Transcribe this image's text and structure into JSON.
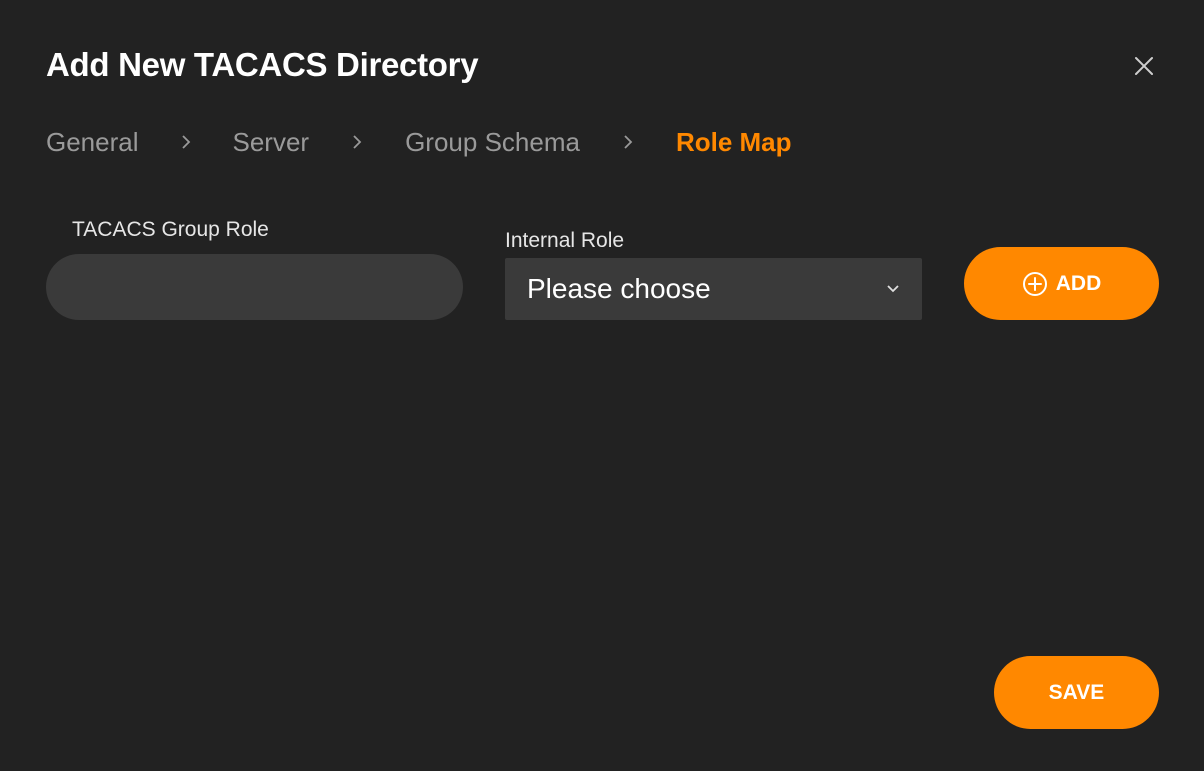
{
  "dialog": {
    "title": "Add New TACACS Directory"
  },
  "breadcrumb": {
    "steps": [
      {
        "label": "General",
        "active": false
      },
      {
        "label": "Server",
        "active": false
      },
      {
        "label": "Group Schema",
        "active": false
      },
      {
        "label": "Role Map",
        "active": true
      }
    ]
  },
  "form": {
    "group_role_label": "TACACS Group Role",
    "group_role_value": "",
    "internal_role_label": "Internal Role",
    "internal_role_selected": "Please choose",
    "add_label": "ADD"
  },
  "footer": {
    "save_label": "SAVE"
  },
  "colors": {
    "background": "#222222",
    "accent": "#ff8800",
    "input_bg": "#3a3a3a",
    "muted_text": "#9a9a9a"
  },
  "icons": {
    "close": "close-icon",
    "chevron": "chevron-right-icon",
    "dropdown": "chevron-down-icon",
    "add": "plus-circle-icon"
  }
}
